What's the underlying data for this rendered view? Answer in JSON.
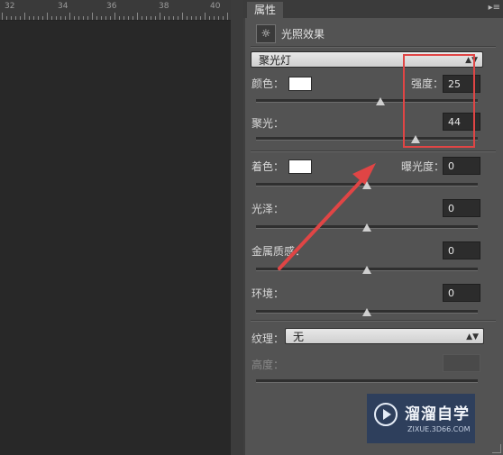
{
  "ruler": {
    "labels": [
      "32",
      "34",
      "36",
      "38",
      "40"
    ]
  },
  "panel": {
    "tab_label": "属性",
    "menu_glyph": "▸≡",
    "effect_icon_glyph": "☼",
    "effect_title": "光照效果",
    "light_type": "聚光灯",
    "color_label": "颜色：",
    "intensity_label": "强度：",
    "intensity_value": "25",
    "intensity_level": 0.56,
    "hotspot_label": "聚光：",
    "hotspot_value": "44",
    "hotspot_level": 0.72,
    "tint_label": "着色：",
    "exposure_label": "曝光度：",
    "exposure_value": "0",
    "exposure_level": 0.5,
    "gloss_label": "光泽：",
    "gloss_value": "0",
    "gloss_level": 0.5,
    "metallic_label": "金属质感：",
    "metallic_value": "0",
    "metallic_level": 0.5,
    "ambience_label": "环境：",
    "ambience_value": "0",
    "ambience_level": 0.5,
    "texture_label": "纹理：",
    "texture_value": "无",
    "height_label": "高度：",
    "height_value": ""
  },
  "watermark": {
    "name": "溜溜自学",
    "url": "ZIXUE.3D66.COM"
  },
  "colors": {
    "annotation_red": "#e04545",
    "panel_bg": "#535353",
    "canvas_bg": "#282828",
    "watermark_bg": "#2e3f5c"
  }
}
